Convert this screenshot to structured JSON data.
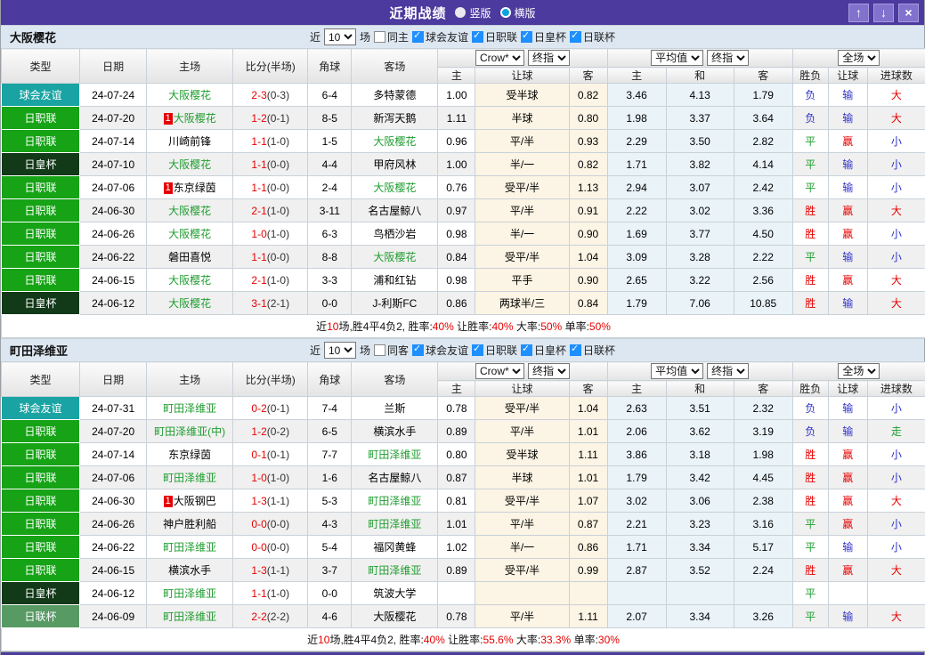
{
  "titlebar": {
    "title": "近期战绩",
    "radios": [
      {
        "label": "竖版",
        "selected": false
      },
      {
        "label": "横版",
        "selected": true
      }
    ],
    "icons": {
      "up": "↑",
      "down": "↓",
      "close": "×"
    }
  },
  "columns": {
    "left": [
      "类型",
      "日期",
      "主场",
      "比分(半场)",
      "角球",
      "客场"
    ],
    "groups": [
      {
        "selects": [
          "Crow*",
          "终指"
        ],
        "cols": [
          "主",
          "让球",
          "客"
        ]
      },
      {
        "selects": [
          "平均值",
          "终指"
        ],
        "cols": [
          "主",
          "和",
          "客"
        ]
      },
      {
        "selects": [
          "全场"
        ],
        "cols": [
          "胜负",
          "让球",
          "进球数"
        ]
      }
    ]
  },
  "type_colors": {
    "球会友谊": "#1aa3a3",
    "日职联": "#16a316",
    "日皇杯": "#123a18",
    "日联杯": "#579a64"
  },
  "result_colors": {
    "胜": "#e60000",
    "赢": "#e60000",
    "大": "#e60000",
    "负": "#3032c8",
    "输": "#3032c8",
    "小": "#3032c8",
    "平": "#1f9d2f",
    "走": "#1f9d2f"
  },
  "sections": [
    {
      "team": "大阪樱花",
      "filter": {
        "recent_label": "近",
        "recent_count": "10",
        "matches_label": "场",
        "same": {
          "label": "同主",
          "checked": false
        },
        "leagues": [
          {
            "label": "球会友谊",
            "checked": true
          },
          {
            "label": "日职联",
            "checked": true
          },
          {
            "label": "日皇杯",
            "checked": true
          },
          {
            "label": "日联杯",
            "checked": true
          }
        ]
      },
      "rows": [
        {
          "type": "球会友谊",
          "date": "24-07-24",
          "home": "大阪樱花",
          "badge": "",
          "score": "2-3",
          "half": "(0-3)",
          "corner": "6-4",
          "away": "多特蒙德",
          "h": "1.00",
          "handicap": "受半球",
          "a": "0.82",
          "avg_h": "3.46",
          "avg_d": "4.13",
          "avg_a": "1.79",
          "wdl": "负",
          "cover": "输",
          "goals": "大"
        },
        {
          "type": "日职联",
          "date": "24-07-20",
          "home": "大阪樱花",
          "badge": "1",
          "score": "1-2",
          "half": "(0-1)",
          "corner": "8-5",
          "away": "新泻天鹅",
          "h": "1.11",
          "handicap": "半球",
          "a": "0.80",
          "avg_h": "1.98",
          "avg_d": "3.37",
          "avg_a": "3.64",
          "wdl": "负",
          "cover": "输",
          "goals": "大"
        },
        {
          "type": "日职联",
          "date": "24-07-14",
          "home": "川崎前锋",
          "badge": "",
          "score": "1-1",
          "half": "(1-0)",
          "corner": "1-5",
          "away": "大阪樱花",
          "h": "0.96",
          "handicap": "平/半",
          "a": "0.93",
          "avg_h": "2.29",
          "avg_d": "3.50",
          "avg_a": "2.82",
          "wdl": "平",
          "cover": "赢",
          "goals": "小"
        },
        {
          "type": "日皇杯",
          "date": "24-07-10",
          "home": "大阪樱花",
          "badge": "",
          "score": "1-1",
          "half": "(0-0)",
          "corner": "4-4",
          "away": "甲府风林",
          "h": "1.00",
          "handicap": "半/一",
          "a": "0.82",
          "avg_h": "1.71",
          "avg_d": "3.82",
          "avg_a": "4.14",
          "wdl": "平",
          "cover": "输",
          "goals": "小"
        },
        {
          "type": "日职联",
          "date": "24-07-06",
          "home": "东京绿茵",
          "badge": "1",
          "score": "1-1",
          "half": "(0-0)",
          "corner": "2-4",
          "away": "大阪樱花",
          "h": "0.76",
          "handicap": "受平/半",
          "a": "1.13",
          "avg_h": "2.94",
          "avg_d": "3.07",
          "avg_a": "2.42",
          "wdl": "平",
          "cover": "输",
          "goals": "小"
        },
        {
          "type": "日职联",
          "date": "24-06-30",
          "home": "大阪樱花",
          "badge": "",
          "score": "2-1",
          "half": "(1-0)",
          "corner": "3-11",
          "away": "名古屋鲸八",
          "h": "0.97",
          "handicap": "平/半",
          "a": "0.91",
          "avg_h": "2.22",
          "avg_d": "3.02",
          "avg_a": "3.36",
          "wdl": "胜",
          "cover": "赢",
          "goals": "大"
        },
        {
          "type": "日职联",
          "date": "24-06-26",
          "home": "大阪樱花",
          "badge": "",
          "score": "1-0",
          "half": "(1-0)",
          "corner": "6-3",
          "away": "鸟栖沙岩",
          "h": "0.98",
          "handicap": "半/一",
          "a": "0.90",
          "avg_h": "1.69",
          "avg_d": "3.77",
          "avg_a": "4.50",
          "wdl": "胜",
          "cover": "赢",
          "goals": "小"
        },
        {
          "type": "日职联",
          "date": "24-06-22",
          "home": "磐田喜悦",
          "badge": "",
          "score": "1-1",
          "half": "(0-0)",
          "corner": "8-8",
          "away": "大阪樱花",
          "h": "0.84",
          "handicap": "受平/半",
          "a": "1.04",
          "avg_h": "3.09",
          "avg_d": "3.28",
          "avg_a": "2.22",
          "wdl": "平",
          "cover": "输",
          "goals": "小"
        },
        {
          "type": "日职联",
          "date": "24-06-15",
          "home": "大阪樱花",
          "badge": "",
          "score": "2-1",
          "half": "(1-0)",
          "corner": "3-3",
          "away": "浦和红钻",
          "h": "0.98",
          "handicap": "平手",
          "a": "0.90",
          "avg_h": "2.65",
          "avg_d": "3.22",
          "avg_a": "2.56",
          "wdl": "胜",
          "cover": "赢",
          "goals": "大"
        },
        {
          "type": "日皇杯",
          "date": "24-06-12",
          "home": "大阪樱花",
          "badge": "",
          "score": "3-1",
          "half": "(2-1)",
          "corner": "0-0",
          "away": "J-利斯FC",
          "h": "0.86",
          "handicap": "两球半/三",
          "a": "0.84",
          "avg_h": "1.79",
          "avg_d": "7.06",
          "avg_a": "10.85",
          "wdl": "胜",
          "cover": "输",
          "goals": "大"
        }
      ],
      "summary": [
        {
          "t": "近",
          "red": false
        },
        {
          "t": "10",
          "red": true
        },
        {
          "t": "场,胜4平4负2, 胜率:",
          "red": false
        },
        {
          "t": "40%",
          "red": true
        },
        {
          "t": " 让胜率:",
          "red": false
        },
        {
          "t": "40%",
          "red": true
        },
        {
          "t": " 大率:",
          "red": false
        },
        {
          "t": "50%",
          "red": true
        },
        {
          "t": " 单率:",
          "red": false
        },
        {
          "t": "50%",
          "red": true
        }
      ]
    },
    {
      "team": "町田泽维亚",
      "filter": {
        "recent_label": "近",
        "recent_count": "10",
        "matches_label": "场",
        "same": {
          "label": "同客",
          "checked": false
        },
        "leagues": [
          {
            "label": "球会友谊",
            "checked": true
          },
          {
            "label": "日职联",
            "checked": true
          },
          {
            "label": "日皇杯",
            "checked": true
          },
          {
            "label": "日联杯",
            "checked": true
          }
        ]
      },
      "rows": [
        {
          "type": "球会友谊",
          "date": "24-07-31",
          "home": "町田泽维亚",
          "badge": "",
          "score": "0-2",
          "half": "(0-1)",
          "corner": "7-4",
          "away": "兰斯",
          "h": "0.78",
          "handicap": "受平/半",
          "a": "1.04",
          "avg_h": "2.63",
          "avg_d": "3.51",
          "avg_a": "2.32",
          "wdl": "负",
          "cover": "输",
          "goals": "小"
        },
        {
          "type": "日职联",
          "date": "24-07-20",
          "home": "町田泽维亚(中)",
          "badge": "",
          "score": "1-2",
          "half": "(0-2)",
          "corner": "6-5",
          "away": "横滨水手",
          "h": "0.89",
          "handicap": "平/半",
          "a": "1.01",
          "avg_h": "2.06",
          "avg_d": "3.62",
          "avg_a": "3.19",
          "wdl": "负",
          "cover": "输",
          "goals": "走"
        },
        {
          "type": "日职联",
          "date": "24-07-14",
          "home": "东京绿茵",
          "badge": "",
          "score": "0-1",
          "half": "(0-1)",
          "corner": "7-7",
          "away": "町田泽维亚",
          "h": "0.80",
          "handicap": "受半球",
          "a": "1.11",
          "avg_h": "3.86",
          "avg_d": "3.18",
          "avg_a": "1.98",
          "wdl": "胜",
          "cover": "赢",
          "goals": "小"
        },
        {
          "type": "日职联",
          "date": "24-07-06",
          "home": "町田泽维亚",
          "badge": "",
          "score": "1-0",
          "half": "(1-0)",
          "corner": "1-6",
          "away": "名古屋鲸八",
          "h": "0.87",
          "handicap": "半球",
          "a": "1.01",
          "avg_h": "1.79",
          "avg_d": "3.42",
          "avg_a": "4.45",
          "wdl": "胜",
          "cover": "赢",
          "goals": "小"
        },
        {
          "type": "日职联",
          "date": "24-06-30",
          "home": "大阪钢巴",
          "badge": "1",
          "score": "1-3",
          "half": "(1-1)",
          "corner": "5-3",
          "away": "町田泽维亚",
          "h": "0.81",
          "handicap": "受平/半",
          "a": "1.07",
          "avg_h": "3.02",
          "avg_d": "3.06",
          "avg_a": "2.38",
          "wdl": "胜",
          "cover": "赢",
          "goals": "大"
        },
        {
          "type": "日职联",
          "date": "24-06-26",
          "home": "神户胜利船",
          "badge": "",
          "score": "0-0",
          "half": "(0-0)",
          "corner": "4-3",
          "away": "町田泽维亚",
          "h": "1.01",
          "handicap": "平/半",
          "a": "0.87",
          "avg_h": "2.21",
          "avg_d": "3.23",
          "avg_a": "3.16",
          "wdl": "平",
          "cover": "赢",
          "goals": "小"
        },
        {
          "type": "日职联",
          "date": "24-06-22",
          "home": "町田泽维亚",
          "badge": "",
          "score": "0-0",
          "half": "(0-0)",
          "corner": "5-4",
          "away": "福冈黄蜂",
          "h": "1.02",
          "handicap": "半/一",
          "a": "0.86",
          "avg_h": "1.71",
          "avg_d": "3.34",
          "avg_a": "5.17",
          "wdl": "平",
          "cover": "输",
          "goals": "小"
        },
        {
          "type": "日职联",
          "date": "24-06-15",
          "home": "横滨水手",
          "badge": "",
          "score": "1-3",
          "half": "(1-1)",
          "corner": "3-7",
          "away": "町田泽维亚",
          "h": "0.89",
          "handicap": "受平/半",
          "a": "0.99",
          "avg_h": "2.87",
          "avg_d": "3.52",
          "avg_a": "2.24",
          "wdl": "胜",
          "cover": "赢",
          "goals": "大"
        },
        {
          "type": "日皇杯",
          "date": "24-06-12",
          "home": "町田泽维亚",
          "badge": "",
          "score": "1-1",
          "half": "(1-0)",
          "corner": "0-0",
          "away": "筑波大学",
          "h": "",
          "handicap": "",
          "a": "",
          "avg_h": "",
          "avg_d": "",
          "avg_a": "",
          "wdl": "平",
          "cover": "",
          "goals": ""
        },
        {
          "type": "日联杯",
          "date": "24-06-09",
          "home": "町田泽维亚",
          "badge": "",
          "score": "2-2",
          "half": "(2-2)",
          "corner": "4-6",
          "away": "大阪樱花",
          "h": "0.78",
          "handicap": "平/半",
          "a": "1.11",
          "avg_h": "2.07",
          "avg_d": "3.34",
          "avg_a": "3.26",
          "wdl": "平",
          "cover": "输",
          "goals": "大"
        }
      ],
      "summary": [
        {
          "t": "近",
          "red": false
        },
        {
          "t": "10",
          "red": true
        },
        {
          "t": "场,胜4平4负2, 胜率:",
          "red": false
        },
        {
          "t": "40%",
          "red": true
        },
        {
          "t": " 让胜率:",
          "red": false
        },
        {
          "t": "55.6%",
          "red": true
        },
        {
          "t": " 大率:",
          "red": false
        },
        {
          "t": "33.3%",
          "red": true
        },
        {
          "t": " 单率:",
          "red": false
        },
        {
          "t": "30%",
          "red": true
        }
      ]
    }
  ]
}
